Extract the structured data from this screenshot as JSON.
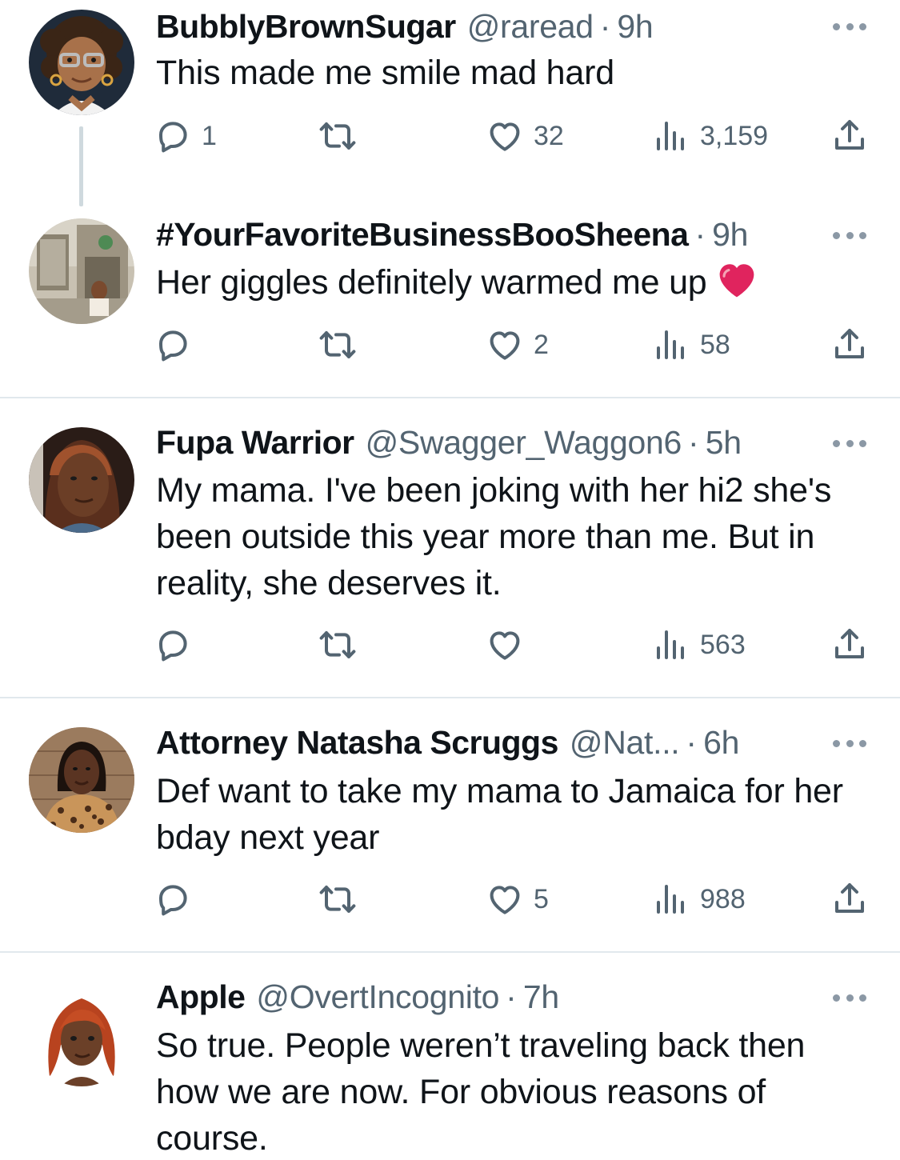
{
  "tweets": [
    {
      "name": "BubblyBrownSugar",
      "handle": "@raread",
      "sep": "·",
      "time": "9h",
      "text": "This made me smile mad hard",
      "replies": "1",
      "likes": "32",
      "views": "3,159",
      "avatar_icon": "memoji-glasses-avatar"
    },
    {
      "name": "#YourFavoriteBusinessBooSheena",
      "handle": "",
      "sep": "·",
      "time": "9h",
      "text": "Her giggles definitely warmed me up",
      "emoji": "red-heart-icon",
      "replies": "",
      "likes": "2",
      "views": "58",
      "avatar_icon": "photo-avatar-storefront"
    },
    {
      "name": "Fupa Warrior",
      "handle": "@Swagger_Waggon6",
      "sep": "·",
      "time": "5h",
      "text": "My mama. I've been joking with her hi2 she's been outside this year more than me. But in reality, she deserves it.",
      "replies": "",
      "likes": "",
      "views": "563",
      "avatar_icon": "photo-avatar-woman"
    },
    {
      "name": "Attorney Natasha Scruggs",
      "handle": "@Nat...",
      "sep": "·",
      "time": "6h",
      "text": "Def want to take my mama to Jamaica for her bday next year",
      "replies": "",
      "likes": "5",
      "views": "988",
      "avatar_icon": "photo-avatar-leopard"
    },
    {
      "name": "Apple",
      "handle": "@OvertIncognito",
      "sep": "·",
      "time": "7h",
      "text": "So true. People weren’t traveling back then how we are now. For obvious reasons of course.",
      "avatar_icon": "memoji-red-hair-avatar"
    }
  ],
  "colors": {
    "text": "#0f1419",
    "secondary": "#536471",
    "divider": "#e1e8ed",
    "thread_line": "#cfd9de",
    "heart": "#e0245e"
  }
}
